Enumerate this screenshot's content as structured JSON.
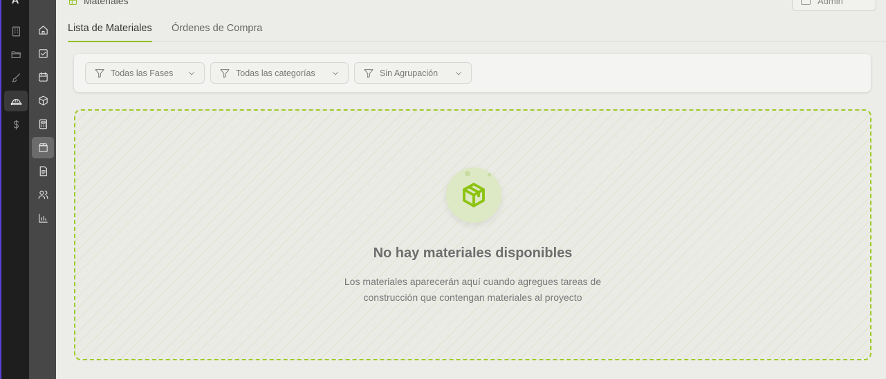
{
  "app": {
    "logo_letter": "A"
  },
  "page": {
    "title": "Materiales"
  },
  "top_right": {
    "label": "Admin"
  },
  "tabs": [
    {
      "label": "Lista de Materiales",
      "active": true
    },
    {
      "label": "Órdenes de Compra",
      "active": false
    }
  ],
  "filters": [
    {
      "label": "Todas las Fases",
      "icon": "filter-icon"
    },
    {
      "label": "Todas las categorías",
      "icon": "filter-icon"
    },
    {
      "label": "Sin Agrupación",
      "icon": "filter-icon"
    }
  ],
  "empty_state": {
    "icon": "package-icon",
    "title": "No hay materiales disponibles",
    "description_line1": "Los materiales aparecerán aquí cuando agregues tareas de",
    "description_line2": "construcción que contengan materiales al proyecto"
  },
  "rail1_icons": [
    "building-icon",
    "folder-icon",
    "brush-icon",
    "hardhat-icon",
    "dollar-icon"
  ],
  "rail2_icons": [
    "home-icon",
    "checkbox-icon",
    "calendar-icon",
    "cube-icon",
    "calculator-icon",
    "package-icon",
    "document-icon",
    "users-icon",
    "bar-chart-icon"
  ],
  "colors": {
    "accent": "#8fc31f",
    "rail_dark": "#1e1e1e",
    "sidebar": "#474747",
    "background": "#ecece8"
  }
}
